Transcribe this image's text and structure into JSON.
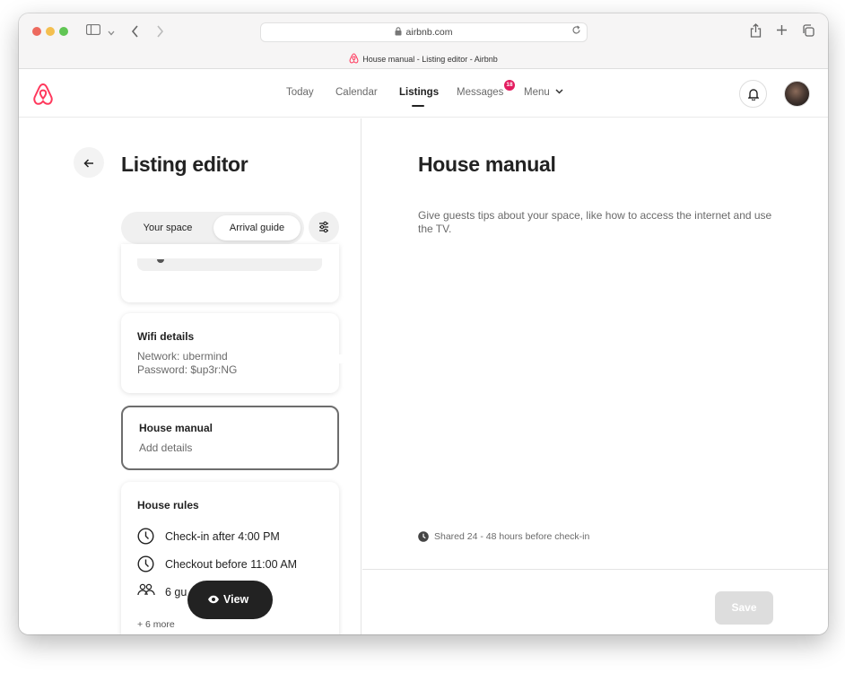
{
  "browser": {
    "url": "airbnb.com",
    "tab_title": "House manual - Listing editor - Airbnb"
  },
  "header": {
    "nav": [
      {
        "label": "Today"
      },
      {
        "label": "Calendar"
      },
      {
        "label": "Listings",
        "active": true
      },
      {
        "label": "Messages",
        "badge": "18"
      },
      {
        "label": "Menu"
      }
    ],
    "brand_color": "#ff385c"
  },
  "editor": {
    "title": "Listing editor",
    "tabs": {
      "your_space": "Your space",
      "arrival_guide": "Arrival guide",
      "selected": "Arrival guide"
    },
    "wifi": {
      "title": "Wifi details",
      "network": "Network: ubermind",
      "password": "Password: $up3r:NG"
    },
    "house_manual": {
      "title": "House manual",
      "value": "Add details"
    },
    "house_rules": {
      "title": "House rules",
      "rules": [
        {
          "label": "Check-in after 4:00 PM",
          "icon": "clock-icon"
        },
        {
          "label": "Checkout before 11:00 AM",
          "icon": "clock-icon"
        },
        {
          "label": "6 gu",
          "icon": "guests-icon"
        }
      ],
      "more": "+ 6 more"
    },
    "view_button": "View"
  },
  "detail": {
    "title": "House manual",
    "description": "Give guests tips about your space, like how to access the internet and use the TV.",
    "shared_note": "Shared 24 - 48 hours before check-in",
    "save": "Save"
  }
}
